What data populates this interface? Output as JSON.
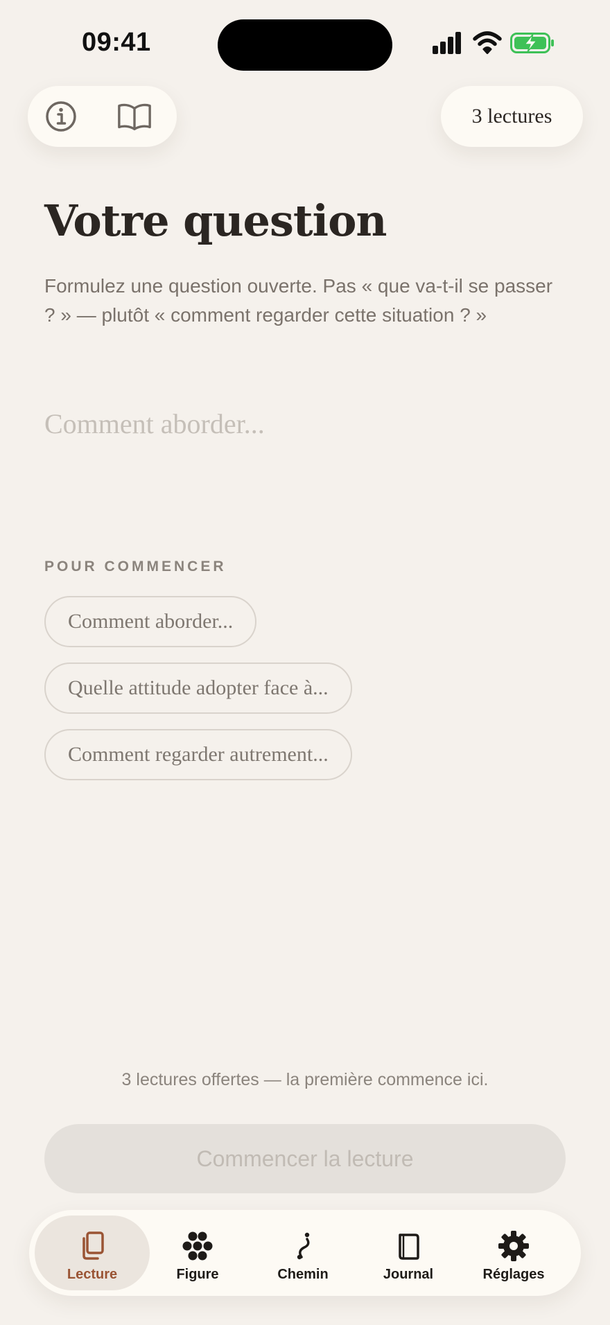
{
  "status_bar": {
    "time": "09:41"
  },
  "header": {
    "readings_count": "3 lectures"
  },
  "main": {
    "title": "Votre question",
    "subtitle": "Formulez une question ouverte. Pas « que va-t-il se passer ? » — plutôt « comment regarder cette situation ? »",
    "question_placeholder": "Comment aborder...",
    "question_value": ""
  },
  "suggestions": {
    "label": "POUR COMMENCER",
    "items": [
      "Comment aborder...",
      "Quelle attitude adopter face à...",
      "Comment regarder autrement..."
    ]
  },
  "footer": {
    "note": "3 lectures offertes — la première commence ici.",
    "cta_label": "Commencer la lecture"
  },
  "tabbar": {
    "active": "Lecture",
    "items": [
      {
        "label": "Lecture",
        "icon": "cards-icon"
      },
      {
        "label": "Figure",
        "icon": "flower-dots-icon"
      },
      {
        "label": "Chemin",
        "icon": "path-icon"
      },
      {
        "label": "Journal",
        "icon": "journal-icon"
      },
      {
        "label": "Réglages",
        "icon": "gear-icon"
      }
    ]
  },
  "colors": {
    "background": "#f5f1ec",
    "surface": "#fdfaf4",
    "accent": "#9a5434",
    "text": "#2b2622",
    "muted": "#7a726b",
    "battery": "#3ec157"
  }
}
